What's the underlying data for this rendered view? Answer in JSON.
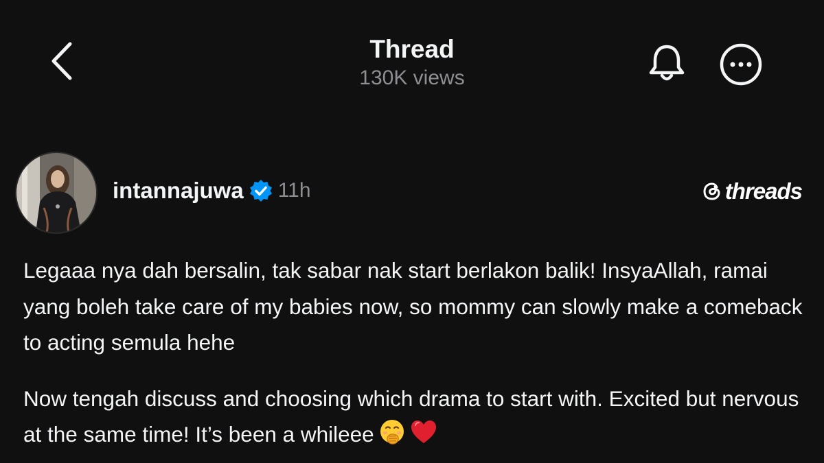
{
  "header": {
    "title": "Thread",
    "views": "130K views",
    "back_icon": "chevron-left-icon",
    "bell_icon": "bell-icon",
    "more_icon": "more-horizontal-icon"
  },
  "post": {
    "username": "intannajuwa",
    "verified": true,
    "time": "11h",
    "brand": "threads",
    "paragraphs": [
      "Legaaa nya dah bersalin, tak sabar nak start berlakon balik! InsyaAllah, ramai yang boleh take care of my babies now, so mommy can slowly make a comeback to acting semula hehe",
      "Now tengah discuss and choosing which drama to start with. Excited but nervous at the same time! It’s been a whileee"
    ],
    "emojis": [
      "face-with-hand-over-mouth",
      "red-heart"
    ]
  },
  "colors": {
    "background": "#101010",
    "text": "#f3f5f7",
    "muted": "#8e8e93",
    "verified_blue": "#0095f6",
    "heart_red": "#e0202f"
  }
}
